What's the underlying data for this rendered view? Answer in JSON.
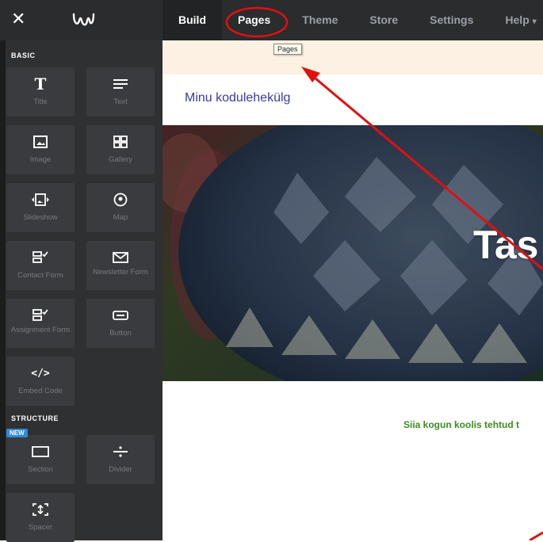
{
  "topbar": {
    "close_icon": "close-icon",
    "logo_icon": "weebly-logo-icon",
    "tabs": [
      {
        "label": "Build",
        "active": true
      },
      {
        "label": "Pages",
        "active": false
      },
      {
        "label": "Theme",
        "active": false
      },
      {
        "label": "Store",
        "active": false
      },
      {
        "label": "Settings",
        "active": false
      },
      {
        "label": "Help",
        "active": false
      }
    ],
    "help_arrow": "▾"
  },
  "sidebar": {
    "basic_label": "BASIC",
    "structure_label": "STRUCTURE",
    "new_badge": "NEW",
    "basic_items": [
      {
        "label": "Title",
        "icon": "title-icon"
      },
      {
        "label": "Text",
        "icon": "text-icon"
      },
      {
        "label": "Image",
        "icon": "image-icon"
      },
      {
        "label": "Gallery",
        "icon": "gallery-icon"
      },
      {
        "label": "Slideshow",
        "icon": "slideshow-icon"
      },
      {
        "label": "Map",
        "icon": "map-pin-icon"
      },
      {
        "label": "Contact Form",
        "icon": "contact-form-icon"
      },
      {
        "label": "Newsletter Form",
        "icon": "newsletter-icon"
      },
      {
        "label": "Assignment Form",
        "icon": "assignment-form-icon"
      },
      {
        "label": "Button",
        "icon": "button-icon"
      },
      {
        "label": "Embed Code",
        "icon": "embed-code-icon"
      }
    ],
    "structure_items": [
      {
        "label": "Section",
        "icon": "section-icon"
      },
      {
        "label": "Divider",
        "icon": "divider-icon"
      },
      {
        "label": "Spacer",
        "icon": "spacer-icon"
      }
    ]
  },
  "canvas": {
    "tooltip": "Pages",
    "site_title": "Minu kodulehekülg",
    "hero_title": "Tas",
    "body_text": "Siia kogun koolis tehtud t"
  },
  "colors": {
    "topbar_bg": "#2b2c2e",
    "sidebar_bg": "#2f3032",
    "tile_bg": "#3a3b3e",
    "notice_bg": "#fdf1e3",
    "site_title": "#3b3aa0",
    "body_text": "#3f8a1f",
    "annotation_red": "#e01010"
  }
}
